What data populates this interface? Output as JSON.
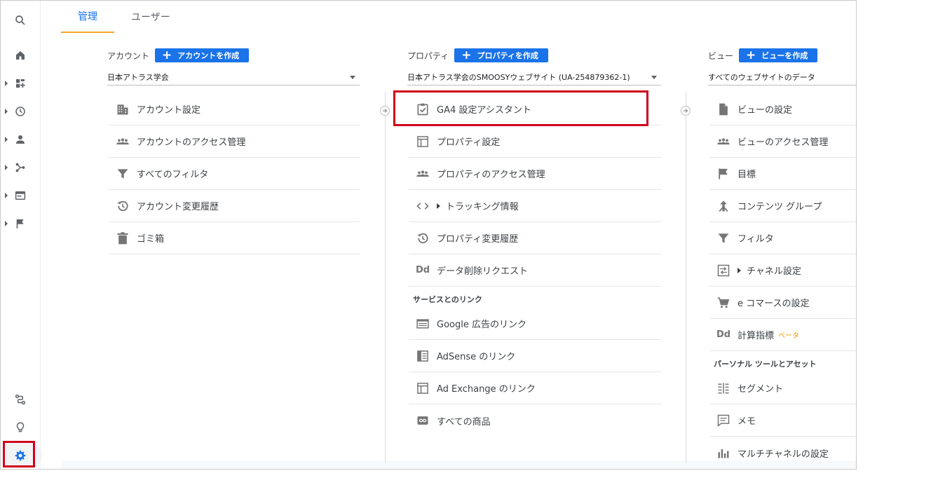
{
  "tabs": [
    {
      "label": "管理",
      "active": true
    },
    {
      "label": "ユーザー",
      "active": false
    }
  ],
  "account": {
    "label": "アカウント",
    "create_button": "アカウントを作成",
    "selected": "日本アトラス学会",
    "items": [
      {
        "label": "アカウント設定",
        "icon": "building-icon"
      },
      {
        "label": "アカウントのアクセス管理",
        "icon": "people-icon"
      },
      {
        "label": "すべてのフィルタ",
        "icon": "filter-icon"
      },
      {
        "label": "アカウント変更履歴",
        "icon": "history-icon"
      },
      {
        "label": "ゴミ箱",
        "icon": "trash-icon"
      }
    ]
  },
  "property": {
    "label": "プロパティ",
    "create_button": "プロパティを作成",
    "selected": "日本アトラス学会のSMOOSYウェブサイト (UA-254879362-1)",
    "items": [
      {
        "label": "GA4 設定アシスタント",
        "icon": "clipboard-check-icon"
      },
      {
        "label": "プロパティ設定",
        "icon": "window-icon"
      },
      {
        "label": "プロパティのアクセス管理",
        "icon": "people-icon"
      },
      {
        "label": "トラッキング情報",
        "icon": "code-icon"
      },
      {
        "label": "プロパティ変更履歴",
        "icon": "history-icon"
      },
      {
        "label": "データ削除リクエスト",
        "icon": "dd-icon",
        "icon_text": "Dd"
      }
    ],
    "services_title": "サービスとのリンク",
    "services": [
      {
        "label": "Google 広告のリンク",
        "icon": "ads-icon"
      },
      {
        "label": "AdSense のリンク",
        "icon": "adsense-icon"
      },
      {
        "label": "Ad Exchange のリンク",
        "icon": "window-icon"
      },
      {
        "label": "すべての商品",
        "icon": "link-icon"
      }
    ]
  },
  "view": {
    "label": "ビュー",
    "create_button": "ビューを作成",
    "selected": "すべてのウェブサイトのデータ",
    "items": [
      {
        "label": "ビューの設定",
        "icon": "document-icon"
      },
      {
        "label": "ビューのアクセス管理",
        "icon": "people-icon"
      },
      {
        "label": "目標",
        "icon": "flag-icon"
      },
      {
        "label": "コンテンツ グループ",
        "icon": "content-group-icon"
      },
      {
        "label": "フィルタ",
        "icon": "filter-icon"
      },
      {
        "label": "チャネル設定",
        "icon": "channel-icon"
      },
      {
        "label": "e コマースの設定",
        "icon": "cart-icon"
      },
      {
        "label": "計算指標",
        "icon": "dd-icon",
        "icon_text": "Dd",
        "badge": "ベータ"
      }
    ],
    "personal_title": "パーソナル ツールとアセット",
    "personal": [
      {
        "label": "セグメント",
        "icon": "segment-icon"
      },
      {
        "label": "メモ",
        "icon": "comment-icon"
      },
      {
        "label": "マルチチャネルの設定",
        "icon": "bar-chart-icon"
      }
    ]
  },
  "colors": {
    "accent": "#1a73e8",
    "highlight": "#d0021b",
    "tab_underline": "#f5a623"
  }
}
